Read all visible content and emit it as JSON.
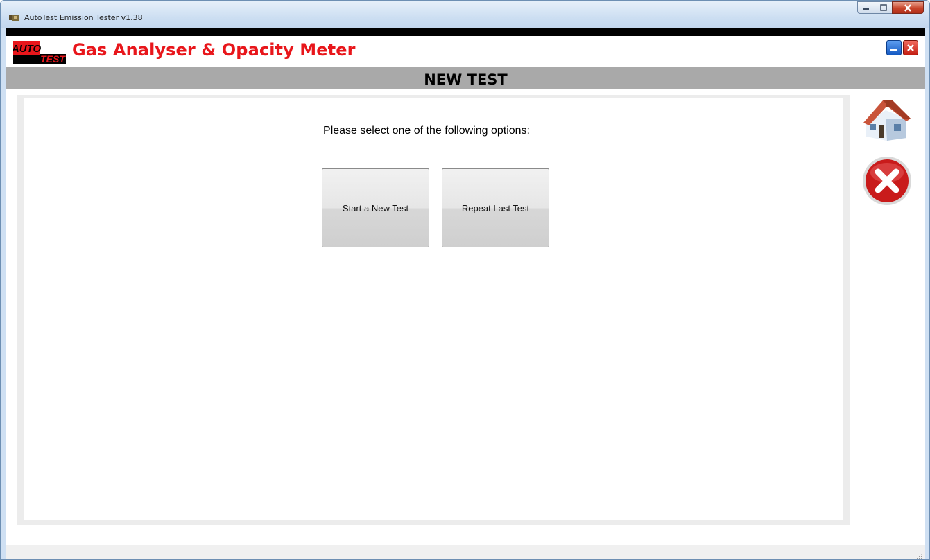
{
  "window": {
    "title": "AutoTest Emission Tester v1.38"
  },
  "header": {
    "logo_top": "AUTO",
    "logo_bottom": "TEST",
    "app_title": "Gas Analyser & Opacity Meter"
  },
  "page": {
    "title": "NEW TEST",
    "prompt": "Please select one of the following options:"
  },
  "options": [
    {
      "label": "Start a New Test"
    },
    {
      "label": "Repeat Last Test"
    }
  ],
  "sidebar": {
    "home_icon": "home-icon",
    "cancel_icon": "cancel-icon"
  },
  "colors": {
    "brand_red": "#e8161b",
    "title_bar": "#a9a9a9"
  }
}
